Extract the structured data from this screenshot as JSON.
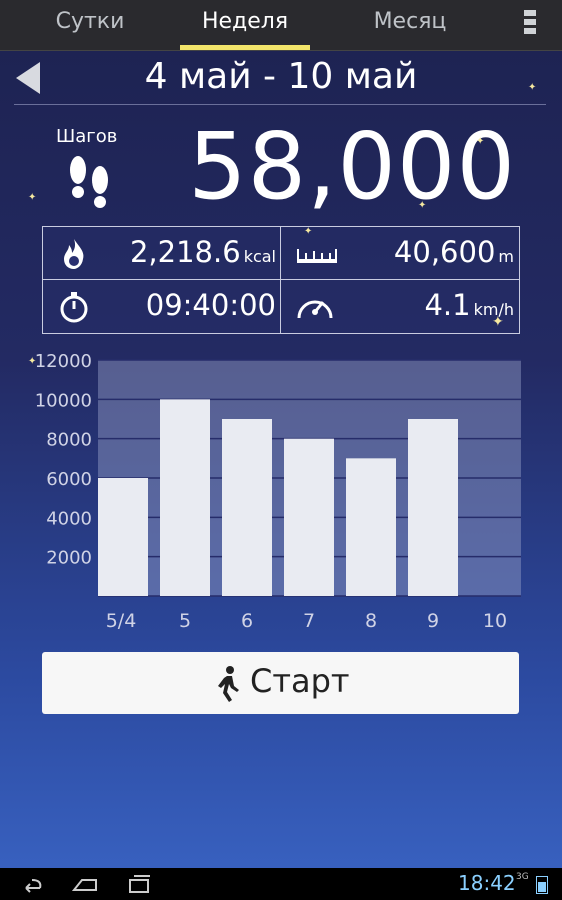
{
  "tabs": [
    {
      "label": "Сутки",
      "active": false
    },
    {
      "label": "Неделя",
      "active": true
    },
    {
      "label": "Месяц",
      "active": false
    }
  ],
  "header": {
    "date_range": "4 май - 10 май"
  },
  "summary": {
    "steps_label": "Шагов",
    "steps_value": "58,000",
    "calories": {
      "value": "2,218.6",
      "unit": "kcal",
      "icon": "flame-icon"
    },
    "distance": {
      "value": "40,600",
      "unit": "m",
      "icon": "ruler-icon"
    },
    "duration": {
      "value": "09:40:00",
      "icon": "stopwatch-icon"
    },
    "speed": {
      "value": "4.1",
      "unit": "km/h",
      "icon": "speedometer-icon"
    }
  },
  "chart_data": {
    "type": "bar",
    "categories": [
      "5/4",
      "5",
      "6",
      "7",
      "8",
      "9",
      "10"
    ],
    "values": [
      6000,
      10000,
      9000,
      8000,
      7000,
      9000,
      0
    ],
    "yticks": [
      2000,
      4000,
      6000,
      8000,
      10000,
      12000
    ],
    "ylim": [
      0,
      12000
    ],
    "grid": true,
    "bar_color": "#e9ebf2"
  },
  "start_button": {
    "label": "Старт",
    "icon": "walking-person-icon"
  },
  "status_bar": {
    "time": "18:42",
    "network": "3G"
  },
  "colors": {
    "accent": "#f2e46a",
    "clock": "#8bd0ff"
  }
}
